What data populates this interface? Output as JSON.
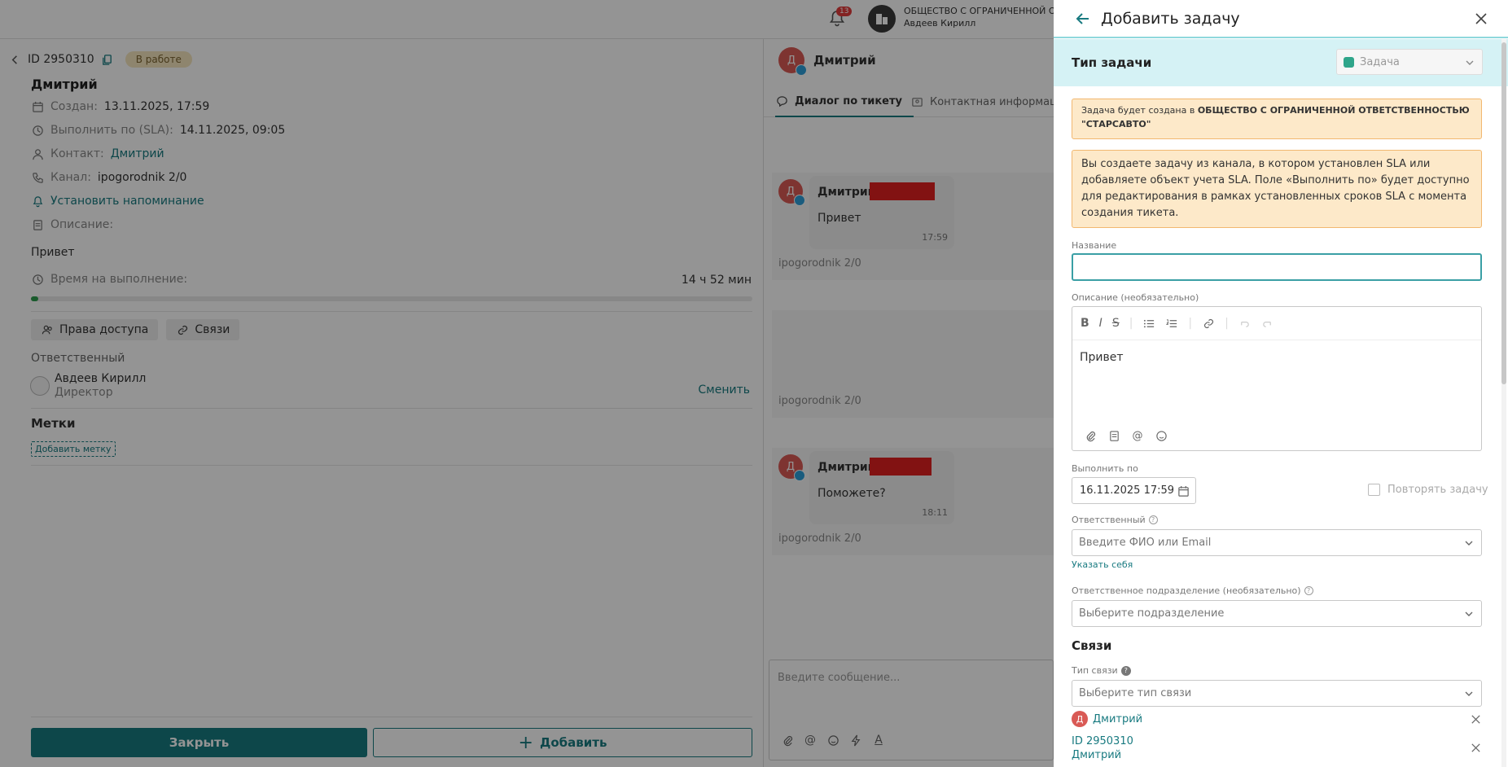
{
  "topbar": {
    "notifications_count": "13",
    "org_name": "ОБЩЕСТВО С ОГРАНИЧЕННОЙ ОТВ",
    "user_name": "Авдеев Кирилл"
  },
  "ticket": {
    "id": "ID 2950310",
    "status": "В работе",
    "client_name": "Дмитрий",
    "created_label": "Создан:",
    "created_value": "13.11.2025, 17:59",
    "sla_label": "Выполнить по (SLA):",
    "sla_value": "14.11.2025, 09:05",
    "contact_label": "Контакт:",
    "contact_value": "Дмитрий",
    "channel_label": "Канал:",
    "channel_value": "ipogorodnik 2/0",
    "reminder_link": "Установить напоминание",
    "description_label": "Описание:",
    "description_value": "Привет",
    "time_label": "Время на выполнение:",
    "time_value": "14 ч 52 мин",
    "time_progress": 0.01,
    "access_button": "Права доступа",
    "links_button": "Связи",
    "responsible_label": "Ответственный",
    "responsible_name": "Авдеев Кирилл",
    "responsible_role": "Директор",
    "change_link": "Сменить",
    "tags_title": "Метки",
    "add_tag": "Добавить метку",
    "close_button": "Закрыть",
    "add_button": "Добавить"
  },
  "chat": {
    "header_name": "Дмитрий",
    "avatar_letter": "Д",
    "tab_dialog": "Диалог по тикету",
    "tab_contact": "Контактная информаци",
    "messages": [
      {
        "author": "Дмитрий",
        "text": "Привет",
        "time": "17:59",
        "channel": "ipogorodnik 2/0"
      },
      {
        "author": "",
        "text": "",
        "time": "",
        "channel": "ipogorodnik 2/0"
      },
      {
        "author": "Дмитрий",
        "text": "Поможете?",
        "time": "18:11",
        "channel": "ipogorodnik 2/0"
      }
    ],
    "input_placeholder": "Введите сообщение..."
  },
  "panel": {
    "title": "Добавить задачу",
    "task_type_label": "Тип задачи",
    "task_type_value": "Задача",
    "info_prefix": "Задача будет создана в ",
    "info_org": "ОБЩЕСТВО С ОГРАНИЧЕННОЙ ОТВЕТСТВЕННОСТЬЮ \"СТАРСАВТО\"",
    "sla_warning": "Вы создаете задачу из канала, в котором установлен SLA или добавляете объект учета SLA. Поле «Выполнить по» будет доступно для редактирования в рамках установленных сроков SLA с момента создания тикета.",
    "name_label": "Название",
    "name_value": "",
    "description_label": "Описание (необязательно)",
    "description_value": "Привет",
    "due_label": "Выполнить по",
    "due_value": "16.11.2025 17:59",
    "repeat_label": "Повторять задачу",
    "responsible_label": "Ответственный",
    "responsible_placeholder": "Введите ФИО или Email",
    "assign_self": "Указать себя",
    "department_label": "Ответственное подразделение (необязательно)",
    "department_placeholder": "Выберите подразделение",
    "links_title": "Связи",
    "link_type_label": "Тип связи",
    "link_type_placeholder": "Выберите тип связи",
    "linked_contact": "Дмитрий",
    "linked_contact_letter": "Д",
    "linked_ticket_id": "ID 2950310",
    "linked_ticket_name": "Дмитрий"
  },
  "colors": {
    "accent": "#187a80",
    "panel_header_bg": "#d5f2f5",
    "warning_bg": "#fde9c9",
    "warning_border": "#f2b870",
    "status_badge": "#f5e6bd",
    "avatar": "#d95a55"
  }
}
